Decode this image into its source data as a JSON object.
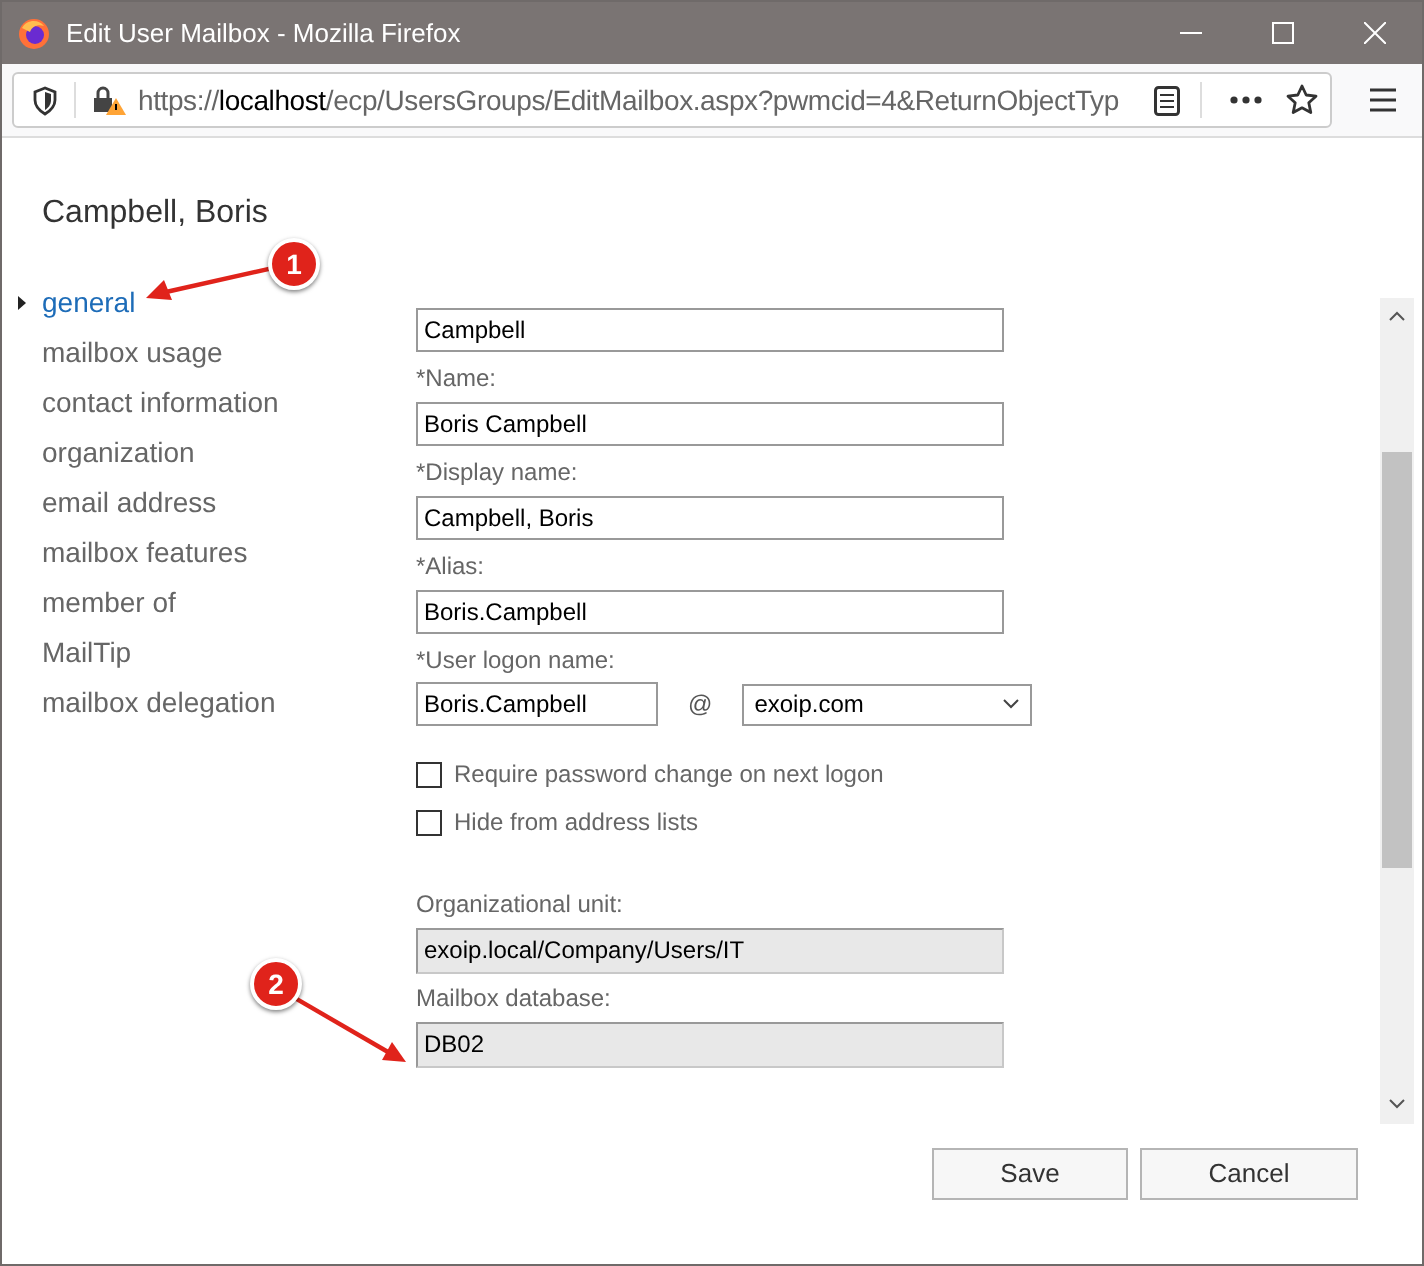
{
  "window": {
    "title": "Edit User Mailbox - Mozilla Firefox"
  },
  "address_bar": {
    "scheme": "https://",
    "host": "localhost",
    "path": "/ecp/UsersGroups/EditMailbox.aspx?pwmcid=4&ReturnObjectTyp"
  },
  "page": {
    "heading": "Campbell, Boris"
  },
  "nav": [
    {
      "label": "general",
      "selected": true
    },
    {
      "label": "mailbox usage",
      "selected": false
    },
    {
      "label": "contact information",
      "selected": false
    },
    {
      "label": "organization",
      "selected": false
    },
    {
      "label": "email address",
      "selected": false
    },
    {
      "label": "mailbox features",
      "selected": false
    },
    {
      "label": "member of",
      "selected": false
    },
    {
      "label": "MailTip",
      "selected": false
    },
    {
      "label": "mailbox delegation",
      "selected": false
    }
  ],
  "form": [
    {
      "kind": "text",
      "value": "Campbell"
    },
    {
      "kind": "text",
      "label": "*Name:",
      "value": "Boris Campbell"
    },
    {
      "kind": "text",
      "label": "*Display name:",
      "value": "Campbell, Boris"
    },
    {
      "kind": "text",
      "label": "*Alias:",
      "value": "Boris.Campbell"
    },
    {
      "kind": "logon",
      "label": "*User logon name:",
      "value": "Boris.Campbell",
      "separator": "@",
      "domain": "exoip.com"
    },
    {
      "kind": "checkbox",
      "label": "Require password change on next logon",
      "checked": false
    },
    {
      "kind": "checkbox",
      "label": "Hide from address lists",
      "checked": false
    },
    {
      "kind": "readonly",
      "label": "Organizational unit:",
      "value": "exoip.local/Company/Users/IT"
    },
    {
      "kind": "readonly",
      "label": "Mailbox database:",
      "value": "DB02"
    }
  ],
  "buttons": [
    "Save",
    "Cancel"
  ],
  "callouts": [
    "1",
    "2"
  ]
}
